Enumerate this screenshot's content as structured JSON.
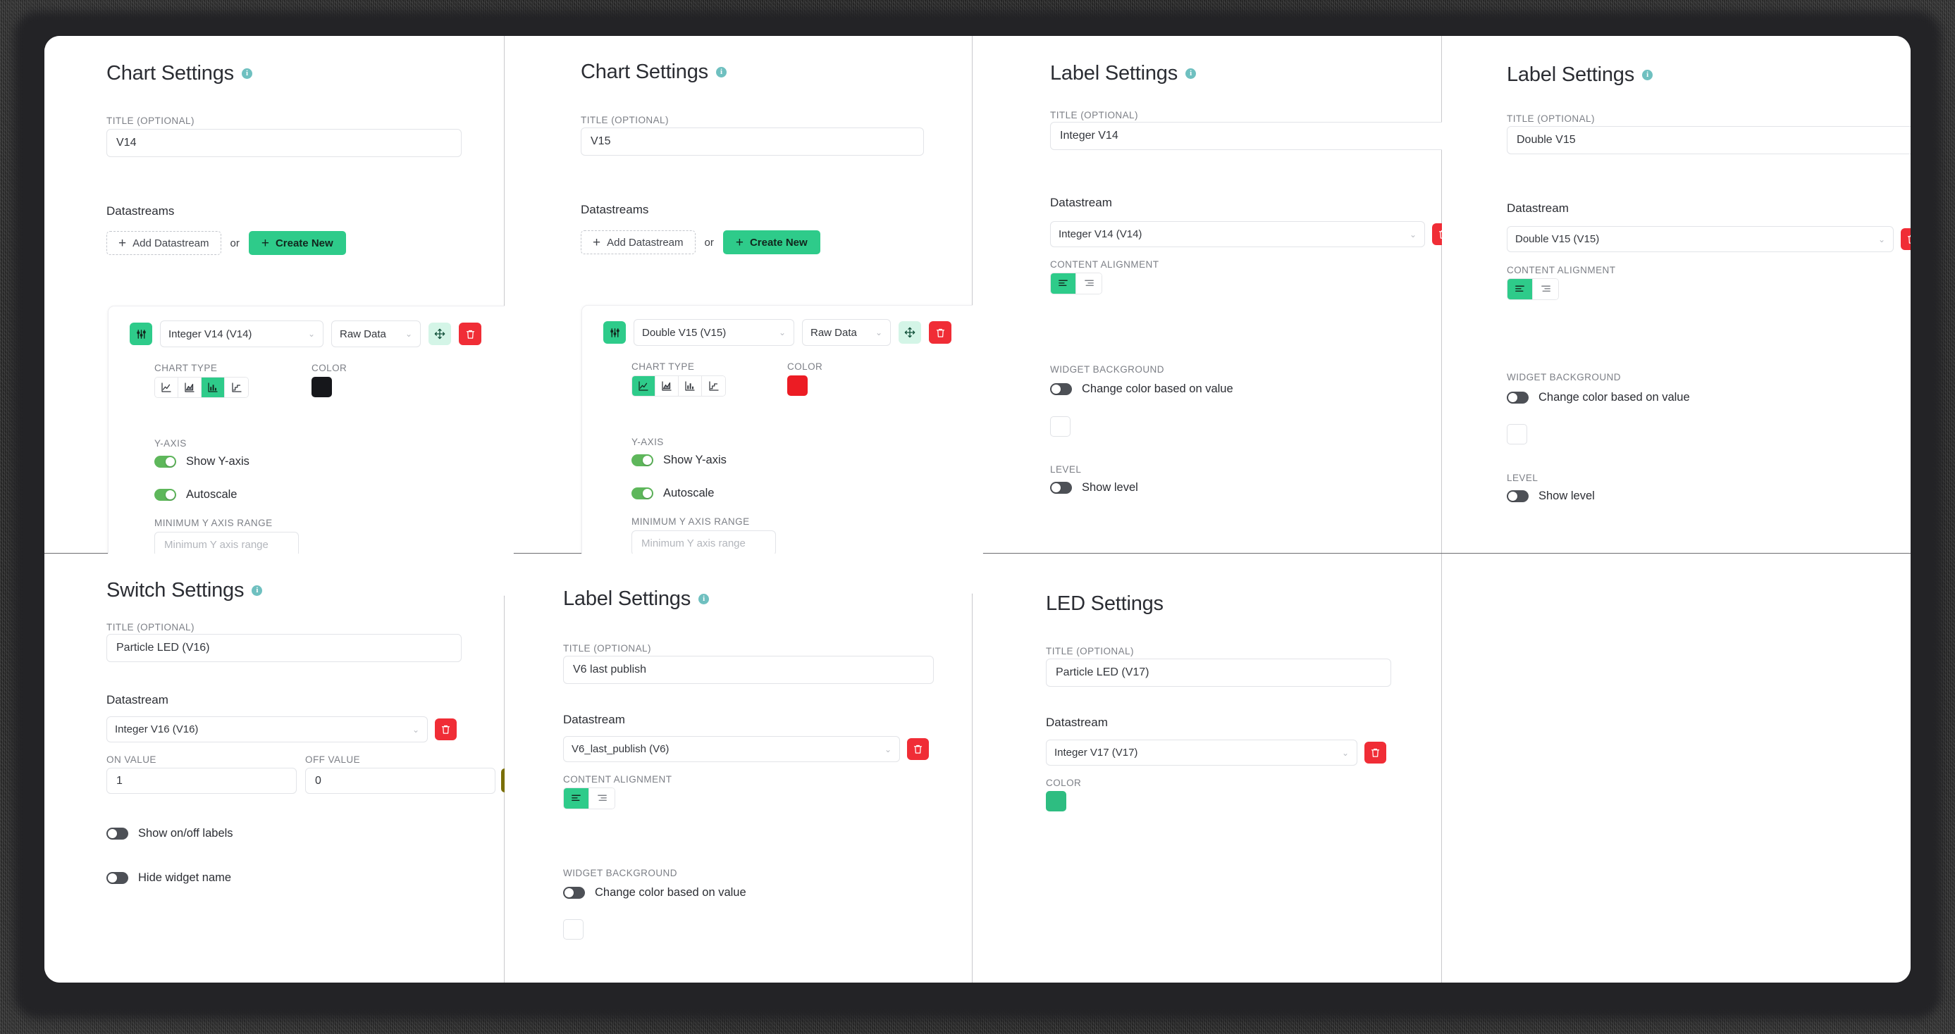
{
  "common": {
    "title_caption": "TITLE (OPTIONAL)",
    "datastream_label": "Datastream",
    "datastreams_label": "Datastreams",
    "chart_type_caption": "CHART TYPE",
    "color_caption": "COLOR",
    "yaxis_caption": "Y-AXIS",
    "min_y_caption": "MINIMUM Y AXIS RANGE",
    "min_y_placeholder": "Minimum Y axis range",
    "content_alignment_caption": "CONTENT ALIGNMENT",
    "widget_background_caption": "WIDGET BACKGROUND",
    "level_caption": "LEVEL",
    "on_value_caption": "ON VALUE",
    "off_value_caption": "OFF VALUE",
    "add_datastream_label": "Add Datastream",
    "or_label": "or",
    "create_new_label": "Create New",
    "plus_glyph": "+",
    "show_yaxis_label": "Show Y-axis",
    "autoscale_label": "Autoscale",
    "change_color_label": "Change color based on value",
    "show_level_label": "Show level",
    "info_glyph": "i",
    "chevron_glyph": "⌄",
    "icons": {
      "info": "info-icon",
      "sliders": "sliders-icon",
      "move": "move-icon",
      "trash": "trash-icon",
      "chart_line": "line-chart-icon",
      "chart_area": "area-chart-icon",
      "chart_bar": "bar-chart-icon",
      "chart_step": "step-chart-icon",
      "align_left": "align-left-icon",
      "align_right": "align-right-icon"
    },
    "colors": {
      "accent_green": "#2ecb8a",
      "toggle_on_green": "#5eb75b",
      "toggle_off_gray": "#4d5056",
      "danger_red": "#f02d36",
      "info_teal": "#6fc0c0"
    }
  },
  "panels": {
    "chart_v14": {
      "heading": "Chart Settings",
      "title_value": "V14",
      "datastream_name": "Integer V14 (V14)",
      "data_mode": "Raw Data",
      "chart_type_selected": "bar",
      "color_value": "#16171b",
      "show_yaxis": true,
      "autoscale": true,
      "min_y_value": ""
    },
    "chart_v15": {
      "heading": "Chart Settings",
      "title_value": "V15",
      "datastream_name": "Double V15 (V15)",
      "data_mode": "Raw Data",
      "chart_type_selected": "line",
      "color_value": "#ec1c24",
      "show_yaxis": true,
      "autoscale": true,
      "min_y_value": ""
    },
    "label_v14": {
      "heading": "Label Settings",
      "title_value": "Integer V14",
      "datastream_name": "Integer V14 (V14)",
      "alignment_selected": "left",
      "change_color_on": false,
      "show_level_on": false
    },
    "label_v15": {
      "heading": "Label Settings",
      "title_value": "Double V15",
      "datastream_name": "Double V15 (V15)",
      "alignment_selected": "left",
      "change_color_on": false,
      "show_level_on": false
    },
    "switch_v16": {
      "heading": "Switch Settings",
      "title_value": "Particle LED (V16)",
      "datastream_name": "Integer V16 (V16)",
      "on_value": "1",
      "off_value": "0",
      "color_value": "#7a6f07",
      "show_onoff_labels_label": "Show on/off labels",
      "show_onoff_labels_on": false,
      "hide_widget_name_label": "Hide widget name",
      "hide_widget_name_on": false
    },
    "label_v6": {
      "heading": "Label Settings",
      "title_value": "V6 last publish",
      "datastream_name": "V6_last_publish (V6)",
      "alignment_selected": "left",
      "change_color_on": false
    },
    "led_v17": {
      "heading": "LED Settings",
      "title_value": "Particle LED (V17)",
      "datastream_name": "Integer V17 (V17)",
      "color_value": "#2ebd81"
    }
  }
}
